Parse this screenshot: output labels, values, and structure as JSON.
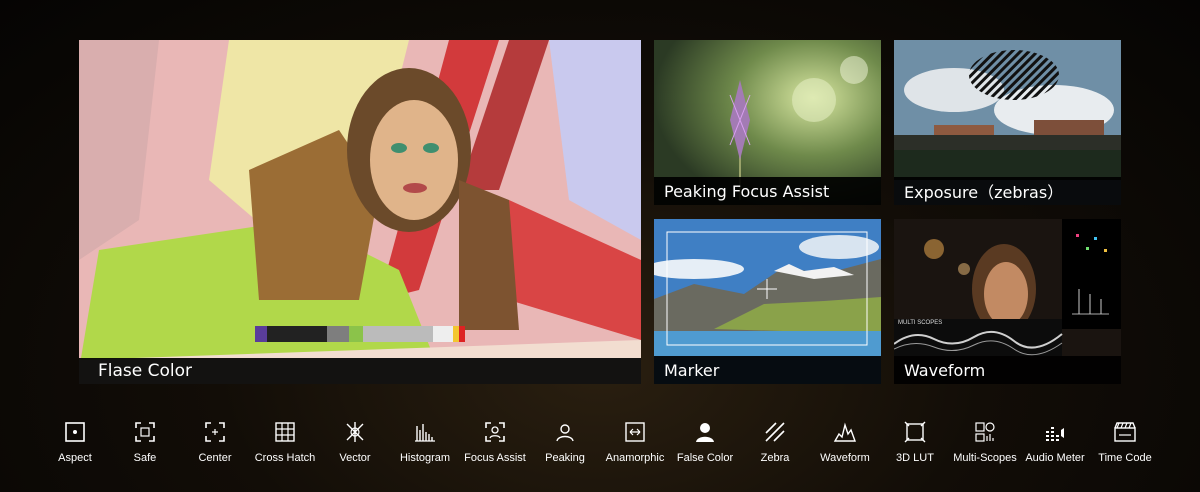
{
  "panels": {
    "false_color": {
      "caption": "Flase Color"
    },
    "peaking": {
      "caption": "Peaking Focus Assist"
    },
    "exposure": {
      "caption": "Exposure（zebras）"
    },
    "marker": {
      "caption": "Marker"
    },
    "waveform": {
      "caption": "Waveform",
      "overlay_label": "MULTI SCOPES"
    }
  },
  "toolbar": {
    "items": [
      {
        "label": "Aspect",
        "icon": "aspect-icon"
      },
      {
        "label": "Safe",
        "icon": "safe-icon"
      },
      {
        "label": "Center",
        "icon": "center-icon"
      },
      {
        "label": "Cross Hatch",
        "icon": "cross-hatch-icon"
      },
      {
        "label": "Vector",
        "icon": "vector-icon"
      },
      {
        "label": "Histogram",
        "icon": "histogram-icon"
      },
      {
        "label": "Focus Assist",
        "icon": "focus-assist-icon"
      },
      {
        "label": "Peaking",
        "icon": "peaking-icon"
      },
      {
        "label": "Anamorphic",
        "icon": "anamorphic-icon"
      },
      {
        "label": "False Color",
        "icon": "false-color-icon"
      },
      {
        "label": "Zebra",
        "icon": "zebra-icon"
      },
      {
        "label": "Waveform",
        "icon": "waveform-icon"
      },
      {
        "label": "3D LUT",
        "icon": "3d-lut-icon"
      },
      {
        "label": "Multi-Scopes",
        "icon": "multi-scopes-icon"
      },
      {
        "label": "Audio Meter",
        "icon": "audio-meter-icon"
      },
      {
        "label": "Time Code",
        "icon": "time-code-icon"
      }
    ]
  }
}
